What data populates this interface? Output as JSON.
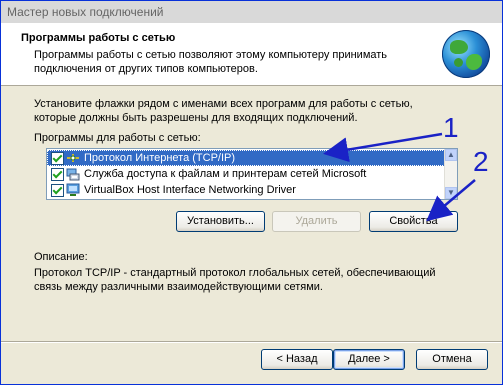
{
  "window": {
    "title": "Мастер новых подключений"
  },
  "header": {
    "title": "Программы работы с сетью",
    "description": "Программы работы с сетью позволяют этому компьютеру принимать подключения от других типов компьютеров."
  },
  "instruction": "Установите флажки рядом с именами всех программ для работы с сетью, которые должны быть разрешены для входящих подключений.",
  "list": {
    "label": "Программы для работы с сетью:",
    "items": [
      {
        "label": "Протокол Интернета (TCP/IP)",
        "checked": true,
        "selected": true,
        "icon": "network-protocol-icon"
      },
      {
        "label": "Служба доступа к файлам и принтерам сетей Microsoft",
        "checked": true,
        "selected": false,
        "icon": "file-printer-sharing-icon"
      },
      {
        "label": "VirtualBox Host Interface Networking Driver",
        "checked": true,
        "selected": false,
        "icon": "network-driver-icon"
      }
    ]
  },
  "buttons": {
    "install": "Установить...",
    "remove": "Удалить",
    "properties": "Свойства",
    "back": "< Назад",
    "next": "Далее >",
    "cancel": "Отмена"
  },
  "description": {
    "label": "Описание:",
    "text": "Протокол TCP/IP - стандартный протокол глобальных сетей, обеспечивающий связь между различными взаимодействующими сетями."
  },
  "annotations": {
    "marker_1": "1",
    "marker_2": "2",
    "color": "#1a22c6"
  },
  "colors": {
    "selection": "#316ac5",
    "window_bg": "#ece9d8",
    "button_border": "#003c74"
  }
}
